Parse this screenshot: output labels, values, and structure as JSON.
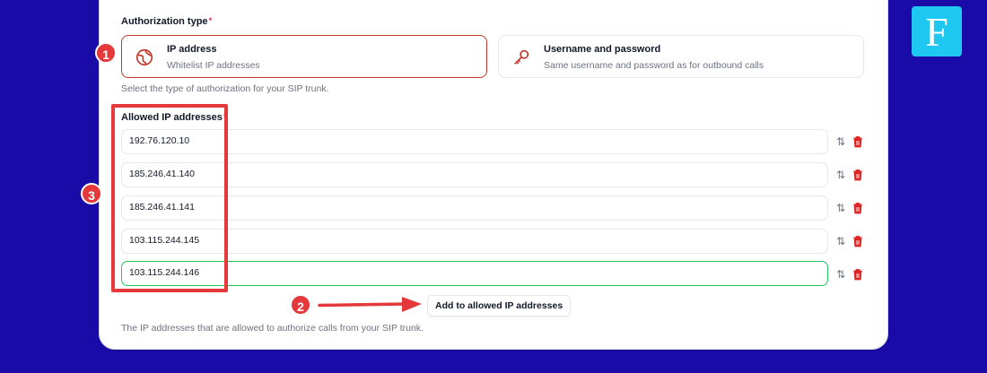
{
  "authorization": {
    "label": "Authorization type",
    "required_mark": "*",
    "helper": "Select the type of authorization for your SIP trunk.",
    "options": [
      {
        "title": "IP address",
        "description": "Whitelist IP addresses",
        "icon": "globe-icon",
        "selected": true
      },
      {
        "title": "Username and password",
        "description": "Same username and password as for outbound calls",
        "icon": "key-icon",
        "selected": false
      }
    ]
  },
  "allowed_ips": {
    "label": "Allowed IP addresses",
    "required_mark": "*",
    "items": [
      "192.76.120.10",
      "185.246.41.140",
      "185.246.41.141",
      "103.115.244.145",
      "103.115.244.146"
    ],
    "add_button": "Add to allowed IP addresses",
    "helper": "The IP addresses that are allowed to authorize calls from your SIP trunk."
  },
  "annotations": {
    "badge_1": "1",
    "badge_2": "2",
    "badge_3": "3",
    "color": "#e5383b"
  },
  "logo": {
    "letter": "F",
    "color": "#1ec8f0"
  },
  "colors": {
    "background": "#1a0aa8",
    "selected_border": "#c0392b",
    "focus_border": "#22c55e",
    "delete": "#dc2626"
  }
}
